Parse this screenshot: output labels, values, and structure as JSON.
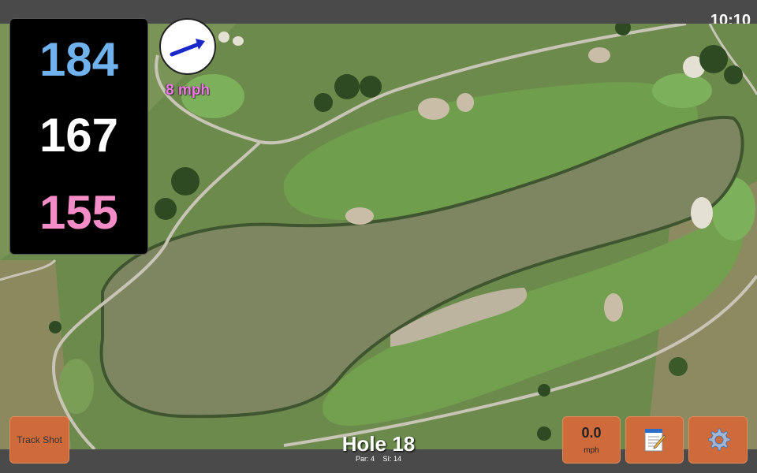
{
  "status": {
    "time": "10:10"
  },
  "distances": {
    "back": "184",
    "middle": "167",
    "front": "155"
  },
  "wind": {
    "speed_label": "8 mph",
    "direction_icon": "wind-arrow-icon"
  },
  "hole": {
    "title": "Hole 18",
    "par_label": "Par: 4",
    "si_label": "SI: 14"
  },
  "buttons": {
    "track_shot_label": "Track Shot",
    "speed_value": "0.0",
    "speed_unit": "mph",
    "notes_icon": "notepad-icon",
    "settings_icon": "gear-icon"
  },
  "colors": {
    "back": "#6fb2ee",
    "middle": "#ffffff",
    "front": "#f48cc8",
    "wind_text": "#ee7ae0",
    "button": "#cf6a3b"
  }
}
